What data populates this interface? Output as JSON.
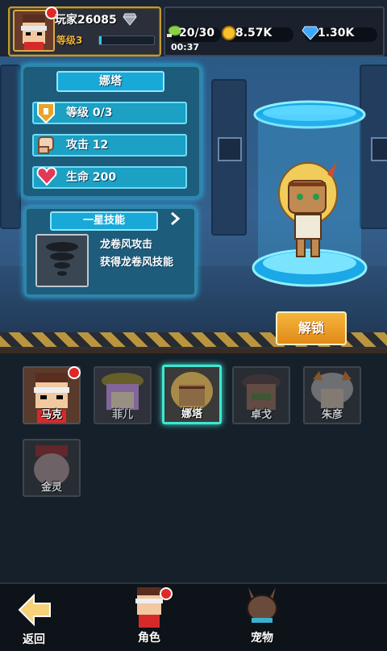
{
  "player": {
    "name": "玩家26085",
    "level_label": "等级3",
    "exp_fraction": 0.05
  },
  "resources": {
    "stamina": "20/30",
    "gold": "8.57K",
    "gems": "1.30K",
    "timer": "00:37"
  },
  "hero": {
    "name": "娜塔",
    "level": "等级  0/3",
    "attack": "攻击  12",
    "hp": "生命  200"
  },
  "skill": {
    "title": "一星技能",
    "line1": "龙卷风攻击",
    "line2": "获得龙卷风技能"
  },
  "unlock_label": "解锁",
  "roster": [
    {
      "name": "马克",
      "selected": false,
      "badge": true
    },
    {
      "name": "菲儿",
      "selected": false,
      "badge": false
    },
    {
      "name": "娜塔",
      "selected": true,
      "badge": false
    },
    {
      "name": "卓戈",
      "selected": false,
      "badge": false
    },
    {
      "name": "朱彦",
      "selected": false,
      "badge": false
    },
    {
      "name": "金灵",
      "selected": false,
      "badge": false
    }
  ],
  "nav": {
    "back": "返回",
    "roles": "角色",
    "pets": "宠物"
  },
  "colors": {
    "accent_cyan": "#27c6ff",
    "gold": "#c49a2c",
    "unlock_orange": "#f6b53c",
    "badge_red": "#e02626"
  }
}
